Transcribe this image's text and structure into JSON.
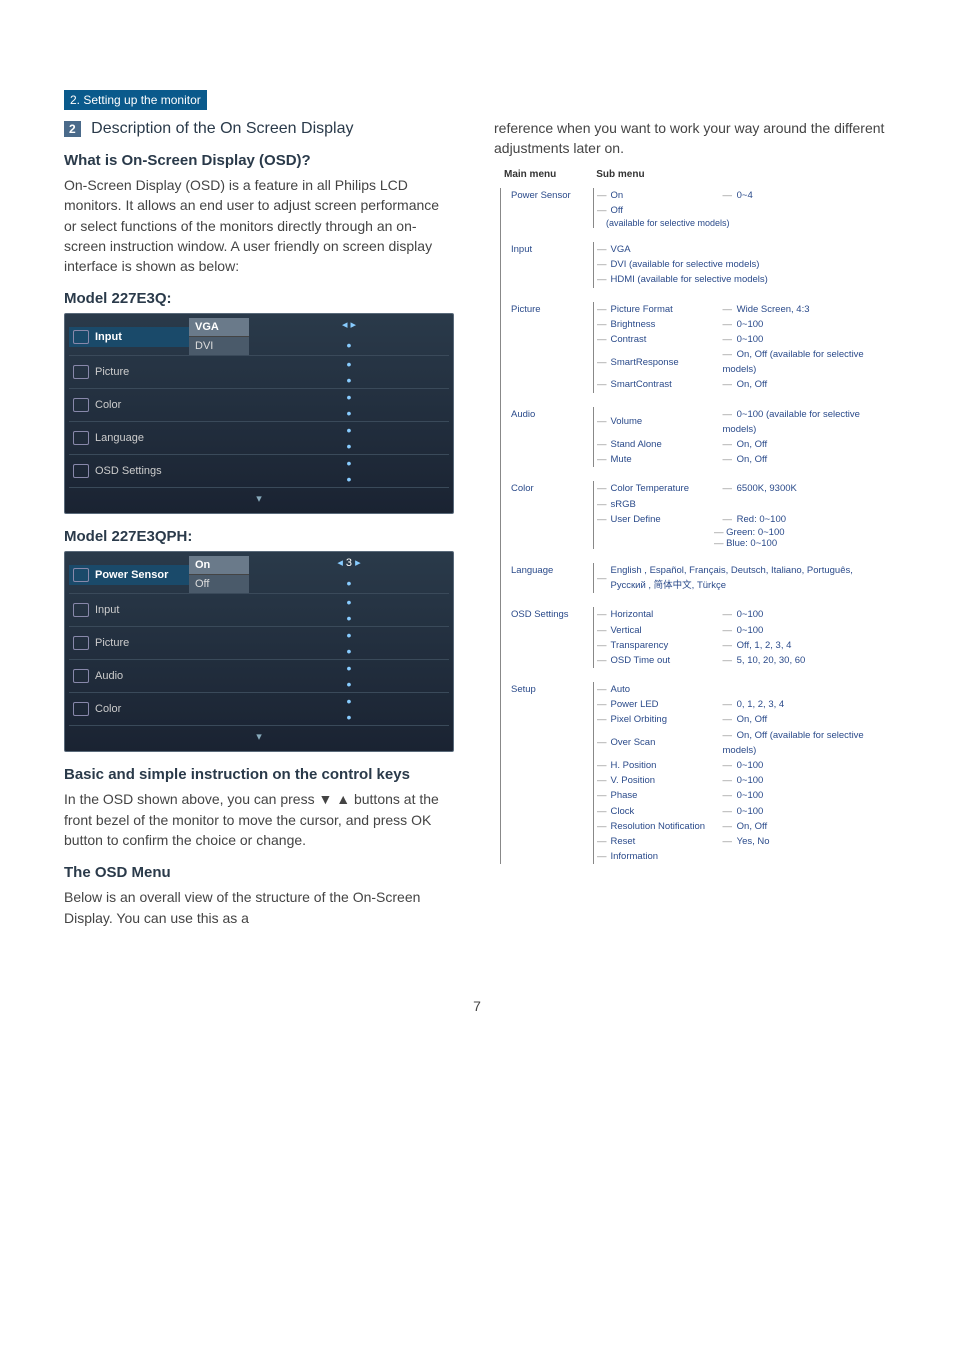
{
  "breadcrumb": "2. Setting up the monitor",
  "section_number": "2",
  "section_title": "Description of the On Screen Display",
  "q_what_is": "What is On-Screen Display (OSD)?",
  "p_what_is": "On-Screen Display (OSD) is a feature in all Philips LCD monitors. It allows an end user to adjust screen performance or select functions of the monitors directly through an on-screen instruction window. A user friendly on screen display interface is shown as below:",
  "model1_title": "Model 227E3Q:",
  "osd1": {
    "items": [
      "Input",
      "Picture",
      "Color",
      "Language",
      "OSD Settings"
    ],
    "sel_top": "VGA",
    "sel_bot": "DVI"
  },
  "model2_title": "Model 227E3QPH:",
  "osd2": {
    "items": [
      "Power Sensor",
      "Input",
      "Picture",
      "Audio",
      "Color"
    ],
    "sel_top": "On",
    "sel_bot": "Off",
    "sel_val": "3"
  },
  "keys_title": "Basic and simple instruction on the control keys",
  "keys_p": "In the OSD shown above, you can press ▼ ▲ buttons at the front bezel of the monitor to move the cursor, and press OK button to confirm the choice or change.",
  "menu_title": "The OSD Menu",
  "menu_p": "Below is an overall view of the structure of the On-Screen Display. You can use this as a",
  "right_intro": "reference when you want to work your way around the different adjustments later on.",
  "header_main": "Main menu",
  "header_sub": "Sub menu",
  "tree": [
    {
      "label": "Power Sensor",
      "subs": [
        {
          "label": "On",
          "val": "0~4"
        },
        {
          "label": "Off",
          "val": ""
        }
      ],
      "note": "(available for selective models)"
    },
    {
      "label": "Input",
      "subs": [
        {
          "label": "VGA",
          "val": ""
        },
        {
          "label": "DVI (available for selective models)",
          "val": "",
          "wide": true
        },
        {
          "label": "HDMI (available for selective models)",
          "val": "",
          "wide": true
        }
      ]
    },
    {
      "label": "Picture",
      "subs": [
        {
          "label": "Picture Format",
          "val": "Wide Screen, 4:3"
        },
        {
          "label": "Brightness",
          "val": "0~100"
        },
        {
          "label": "Contrast",
          "val": "0~100"
        },
        {
          "label": "SmartResponse",
          "val": "On, Off (available for selective models)"
        },
        {
          "label": "SmartContrast",
          "val": "On, Off"
        }
      ]
    },
    {
      "label": "Audio",
      "subs": [
        {
          "label": "Volume",
          "val": "0~100 (available for selective models)"
        },
        {
          "label": "Stand Alone",
          "val": "On, Off"
        },
        {
          "label": "Mute",
          "val": "On, Off"
        }
      ]
    },
    {
      "label": "Color",
      "subs": [
        {
          "label": "Color Temperature",
          "val": "6500K, 9300K"
        },
        {
          "label": "sRGB",
          "val": ""
        },
        {
          "label": "User Define",
          "val": "Red: 0~100",
          "children": [
            "Green: 0~100",
            "Blue: 0~100"
          ]
        }
      ]
    },
    {
      "label": "Language",
      "subs": [
        {
          "label": "English , Español, Français, Deutsch, Italiano, Português, Русский , 简体中文, Türkçe",
          "val": "",
          "wide": true
        }
      ]
    },
    {
      "label": "OSD Settings",
      "subs": [
        {
          "label": "Horizontal",
          "val": "0~100"
        },
        {
          "label": "Vertical",
          "val": "0~100"
        },
        {
          "label": "Transparency",
          "val": "Off, 1, 2, 3, 4"
        },
        {
          "label": "OSD Time out",
          "val": "5, 10, 20, 30, 60"
        }
      ]
    },
    {
      "label": "Setup",
      "subs": [
        {
          "label": "Auto",
          "val": ""
        },
        {
          "label": "Power LED",
          "val": "0, 1, 2, 3, 4"
        },
        {
          "label": "Pixel Orbiting",
          "val": "On, Off"
        },
        {
          "label": "Over Scan",
          "val": "On, Off (available for selective models)"
        },
        {
          "label": "H. Position",
          "val": "0~100"
        },
        {
          "label": "V. Position",
          "val": "0~100"
        },
        {
          "label": "Phase",
          "val": "0~100"
        },
        {
          "label": "Clock",
          "val": "0~100"
        },
        {
          "label": "Resolution Notification",
          "val": "On, Off"
        },
        {
          "label": "Reset",
          "val": "Yes, No"
        },
        {
          "label": "Information",
          "val": ""
        }
      ]
    }
  ],
  "page_number": "7"
}
